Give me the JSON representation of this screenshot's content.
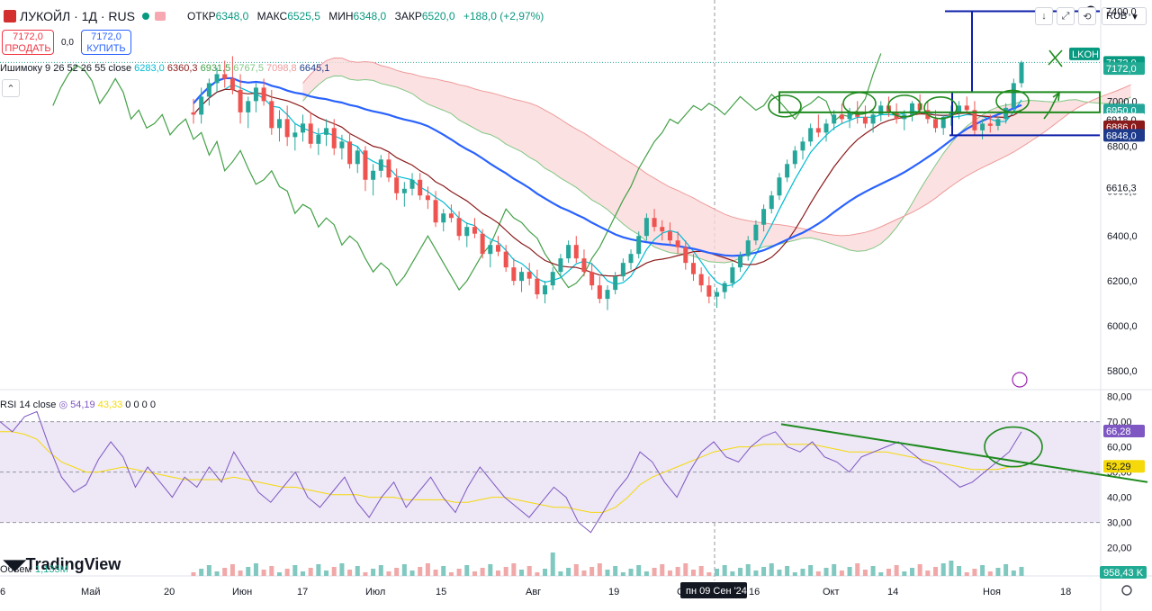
{
  "header": {
    "symbol": "ЛУКОЙЛ · 1Д · RUS",
    "open_label": "ОТКР",
    "open": "6348,0",
    "high_label": "МАКС",
    "high": "6525,5",
    "low_label": "МИН",
    "low": "6348,0",
    "close_label": "ЗАКР",
    "close": "6520,0",
    "change": "+188,0 (+2,97%)"
  },
  "trade": {
    "sell_price": "7172,0",
    "sell_label": "ПРОДАТЬ",
    "spread": "0,0",
    "buy_price": "7172,0",
    "buy_label": "КУПИТЬ"
  },
  "ichimoku_legend": {
    "name": "Ишимоку 9 26 52 26 55 close",
    "values": [
      "6283,0",
      "6360,3",
      "6931,5",
      "6767,5",
      "7098,8",
      "6645,1"
    ]
  },
  "rsi_legend": {
    "name": "RSI 14 close",
    "rsi": "54,19",
    "ma": "43,33",
    "rest": "0  0  0  0"
  },
  "volume_legend": {
    "name": "Объем",
    "value": "1,135M"
  },
  "logo": "TradingView",
  "currency": "RUB",
  "icons": [
    "arrow-down-icon",
    "fullscreen-icon",
    "reset-icon"
  ],
  "colors": {
    "up": "#26a69a",
    "down": "#ef5350",
    "ma_blue": "#2962ff",
    "rsi": "#7e57c2",
    "drawing": "#1e8a1e",
    "kumo_bear": "#fadadb",
    "kumo_bull": "#d4ecd4"
  },
  "chart_data": {
    "type": "candlestick",
    "symbol": "LKOH",
    "price_axis": [
      "7000,0",
      "6800,0",
      "6600,0",
      "6400,0",
      "6200,0",
      "6000,0",
      "5800,0"
    ],
    "price_labels": [
      {
        "text": "7400,0",
        "color": "#131722",
        "bg": "#ffffff"
      },
      {
        "text": "LKOH",
        "color": "#ffffff",
        "bg": "#089981"
      },
      {
        "text": "7172,0",
        "color": "#ffffff",
        "bg": "#089981"
      },
      {
        "text": "7172,0",
        "color": "#ffffff",
        "bg": "#22ab94"
      },
      {
        "text": "6950,0",
        "color": "#ffffff",
        "bg": "#26a69a"
      },
      {
        "text": "6918,0",
        "color": "#131722",
        "bg": "#ffffff"
      },
      {
        "text": "6886,0",
        "color": "#ffffff",
        "bg": "#8b1a1a"
      },
      {
        "text": "6848,0",
        "color": "#ffffff",
        "bg": "#1e3a8a"
      },
      {
        "text": "6616,3",
        "color": "#131722",
        "bg": "#ffffff"
      }
    ],
    "time_axis": [
      "6",
      "Май",
      "20",
      "Июн",
      "17",
      "Июл",
      "15",
      "Авг",
      "19",
      "Сен",
      "16",
      "Окт",
      "14",
      "Ноя",
      "18"
    ],
    "crosshair_date": "пн 09 Сен '24",
    "rsi_axis": [
      "80,00",
      "70,00",
      "60,00",
      "50,00",
      "40,00",
      "30,00",
      "20,00"
    ],
    "rsi_labels": [
      {
        "text": "66,28",
        "color": "#ffffff",
        "bg": "#7e57c2"
      },
      {
        "text": "52,29",
        "color": "#131722",
        "bg": "#f5d90a"
      }
    ],
    "volume_label": "958,43 K",
    "ohlc": [
      [
        6950,
        7010,
        6900,
        6940
      ],
      [
        6940,
        7060,
        6900,
        7020
      ],
      [
        7020,
        7100,
        6980,
        7080
      ],
      [
        7080,
        7150,
        7040,
        7120
      ],
      [
        7120,
        7180,
        7060,
        7100
      ],
      [
        7100,
        7200,
        7030,
        7050
      ],
      [
        7050,
        7120,
        6900,
        6950
      ],
      [
        6950,
        7020,
        6880,
        7000
      ],
      [
        7000,
        7080,
        6950,
        7060
      ],
      [
        7060,
        7100,
        6980,
        7000
      ],
      [
        7000,
        7050,
        6850,
        6880
      ],
      [
        6880,
        6960,
        6820,
        6920
      ],
      [
        6920,
        6980,
        6800,
        6840
      ],
      [
        6840,
        6900,
        6780,
        6860
      ],
      [
        6860,
        6940,
        6820,
        6900
      ],
      [
        6900,
        6950,
        6790,
        6810
      ],
      [
        6810,
        6880,
        6760,
        6850
      ],
      [
        6850,
        6920,
        6800,
        6880
      ],
      [
        6880,
        6920,
        6760,
        6790
      ],
      [
        6790,
        6850,
        6740,
        6820
      ],
      [
        6820,
        6860,
        6700,
        6720
      ],
      [
        6720,
        6800,
        6680,
        6780
      ],
      [
        6780,
        6800,
        6600,
        6650
      ],
      [
        6650,
        6720,
        6580,
        6690
      ],
      [
        6690,
        6760,
        6660,
        6740
      ],
      [
        6740,
        6770,
        6640,
        6660
      ],
      [
        6660,
        6700,
        6560,
        6590
      ],
      [
        6590,
        6640,
        6530,
        6610
      ],
      [
        6610,
        6680,
        6580,
        6650
      ],
      [
        6650,
        6680,
        6560,
        6580
      ],
      [
        6580,
        6620,
        6520,
        6560
      ],
      [
        6560,
        6600,
        6440,
        6460
      ],
      [
        6460,
        6520,
        6420,
        6500
      ],
      [
        6500,
        6540,
        6460,
        6480
      ],
      [
        6480,
        6510,
        6380,
        6400
      ],
      [
        6400,
        6460,
        6350,
        6440
      ],
      [
        6440,
        6480,
        6390,
        6410
      ],
      [
        6410,
        6430,
        6300,
        6320
      ],
      [
        6320,
        6380,
        6260,
        6360
      ],
      [
        6360,
        6400,
        6310,
        6330
      ],
      [
        6330,
        6360,
        6240,
        6260
      ],
      [
        6260,
        6300,
        6180,
        6200
      ],
      [
        6200,
        6260,
        6150,
        6240
      ],
      [
        6240,
        6280,
        6180,
        6210
      ],
      [
        6210,
        6250,
        6120,
        6140
      ],
      [
        6140,
        6200,
        6100,
        6180
      ],
      [
        6180,
        6260,
        6160,
        6240
      ],
      [
        6240,
        6320,
        6220,
        6300
      ],
      [
        6300,
        6380,
        6280,
        6360
      ],
      [
        6360,
        6400,
        6280,
        6300
      ],
      [
        6300,
        6340,
        6220,
        6240
      ],
      [
        6240,
        6280,
        6160,
        6180
      ],
      [
        6180,
        6220,
        6100,
        6120
      ],
      [
        6120,
        6180,
        6070,
        6160
      ],
      [
        6160,
        6240,
        6140,
        6220
      ],
      [
        6220,
        6300,
        6200,
        6280
      ],
      [
        6280,
        6340,
        6250,
        6320
      ],
      [
        6320,
        6420,
        6300,
        6400
      ],
      [
        6400,
        6500,
        6380,
        6480
      ],
      [
        6480,
        6520,
        6420,
        6440
      ],
      [
        6440,
        6470,
        6380,
        6420
      ],
      [
        6420,
        6460,
        6360,
        6380
      ],
      [
        6380,
        6420,
        6320,
        6350
      ],
      [
        6350,
        6380,
        6250,
        6280
      ],
      [
        6280,
        6320,
        6200,
        6230
      ],
      [
        6230,
        6260,
        6150,
        6180
      ],
      [
        6180,
        6220,
        6100,
        6130
      ],
      [
        6130,
        6170,
        6080,
        6150
      ],
      [
        6150,
        6200,
        6120,
        6190
      ],
      [
        6190,
        6280,
        6170,
        6260
      ],
      [
        6260,
        6330,
        6240,
        6310
      ],
      [
        6310,
        6400,
        6290,
        6380
      ],
      [
        6380,
        6470,
        6360,
        6450
      ],
      [
        6450,
        6540,
        6420,
        6520
      ],
      [
        6520,
        6600,
        6500,
        6580
      ],
      [
        6580,
        6680,
        6560,
        6660
      ],
      [
        6660,
        6740,
        6640,
        6720
      ],
      [
        6720,
        6800,
        6700,
        6780
      ],
      [
        6780,
        6840,
        6740,
        6820
      ],
      [
        6820,
        6900,
        6800,
        6880
      ],
      [
        6880,
        6940,
        6840,
        6860
      ],
      [
        6860,
        6920,
        6820,
        6900
      ],
      [
        6900,
        6960,
        6870,
        6940
      ],
      [
        6940,
        6990,
        6900,
        6920
      ],
      [
        6920,
        6970,
        6880,
        6950
      ],
      [
        6950,
        7000,
        6900,
        6930
      ],
      [
        6930,
        6980,
        6880,
        6900
      ],
      [
        6900,
        6960,
        6860,
        6940
      ],
      [
        6940,
        7000,
        6910,
        6980
      ],
      [
        6980,
        7020,
        6930,
        6950
      ],
      [
        6950,
        6990,
        6900,
        6920
      ],
      [
        6920,
        6960,
        6870,
        6940
      ],
      [
        6940,
        7000,
        6910,
        6990
      ],
      [
        6990,
        7030,
        6940,
        6960
      ],
      [
        6960,
        7000,
        6900,
        6920
      ],
      [
        6920,
        6960,
        6860,
        6880
      ],
      [
        6880,
        6940,
        6850,
        6930
      ],
      [
        6930,
        6980,
        6890,
        6950
      ],
      [
        6950,
        7000,
        6920,
        6980
      ],
      [
        6980,
        7020,
        6940,
        6960
      ],
      [
        6960,
        7000,
        6850,
        6870
      ],
      [
        6870,
        6920,
        6830,
        6900
      ],
      [
        6900,
        6940,
        6860,
        6890
      ],
      [
        6890,
        6930,
        6870,
        6920
      ],
      [
        6920,
        6990,
        6900,
        6970
      ],
      [
        6970,
        7100,
        6950,
        7080
      ],
      [
        7080,
        7180,
        7060,
        7172
      ]
    ],
    "series": [
      {
        "name": "RSI 14 close",
        "values": [
          70,
          66,
          72,
          74,
          60,
          48,
          42,
          45,
          55,
          62,
          56,
          44,
          52,
          46,
          40,
          48,
          44,
          52,
          46,
          58,
          50,
          42,
          38,
          44,
          50,
          40,
          36,
          42,
          48,
          38,
          32,
          40,
          46,
          36,
          42,
          48,
          40,
          34,
          44,
          52,
          46,
          40,
          36,
          32,
          38,
          44,
          40,
          30,
          26,
          34,
          42,
          48,
          58,
          54,
          46,
          40,
          50,
          58,
          62,
          56,
          54,
          60,
          64,
          66,
          60,
          58,
          62,
          56,
          54,
          50,
          56,
          58,
          60,
          62,
          58,
          54,
          52,
          48,
          44,
          46,
          50,
          54,
          58,
          66
        ]
      },
      {
        "name": "52,29",
        "values": [
          66,
          66,
          65,
          63,
          58,
          54,
          52,
          50,
          50,
          51,
          52,
          51,
          50,
          49,
          48,
          47,
          47,
          47,
          47,
          48,
          47,
          46,
          45,
          44,
          44,
          43,
          42,
          41,
          41,
          41,
          40,
          40,
          40,
          39,
          39,
          39,
          39,
          38,
          38,
          39,
          40,
          40,
          39,
          38,
          37,
          36,
          36,
          35,
          34,
          34,
          36,
          40,
          45,
          48,
          50,
          52,
          54,
          56,
          58,
          59,
          60,
          60,
          61,
          61,
          61,
          61,
          61,
          60,
          59,
          58,
          58,
          58,
          58,
          57,
          56,
          55,
          54,
          53,
          52,
          51,
          51,
          51,
          52,
          52
        ]
      }
    ],
    "ylim": [
      5720,
      7450
    ],
    "rsi_ylim": [
      17,
      82
    ]
  }
}
